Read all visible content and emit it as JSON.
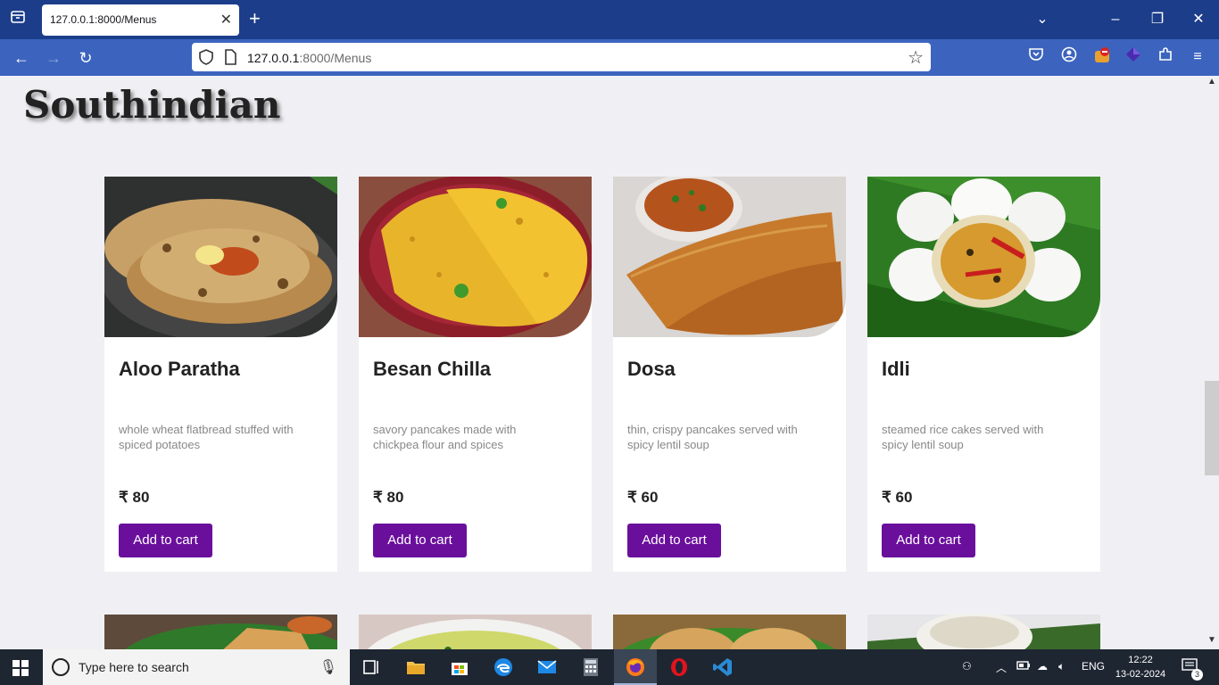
{
  "browser": {
    "tab_title": "127.0.0.1:8000/Menus",
    "url_host": "127.0.0.1",
    "url_rest": ":8000/Menus"
  },
  "page": {
    "section_title": "Southindian",
    "items": [
      {
        "name": "Aloo Paratha",
        "description": "whole wheat flatbread stuffed with spiced potatoes",
        "price": "₹ 80",
        "button": "Add to cart"
      },
      {
        "name": "Besan Chilla",
        "description": "savory pancakes made with chickpea flour and spices",
        "price": "₹ 80",
        "button": "Add to cart"
      },
      {
        "name": "Dosa",
        "description": "thin, crispy pancakes served with spicy lentil soup",
        "price": "₹ 60",
        "button": "Add to cart"
      },
      {
        "name": "Idli",
        "description": "steamed rice cakes served with spicy lentil soup",
        "price": "₹ 60",
        "button": "Add to cart"
      }
    ]
  },
  "taskbar": {
    "search_placeholder": "Type here to search",
    "language": "ENG",
    "time": "12:22",
    "date": "13-02-2024",
    "notifications": "3"
  },
  "colors": {
    "tabbar": "#1c3d8a",
    "navbar": "#3c64be",
    "button": "#6a0f9c"
  }
}
